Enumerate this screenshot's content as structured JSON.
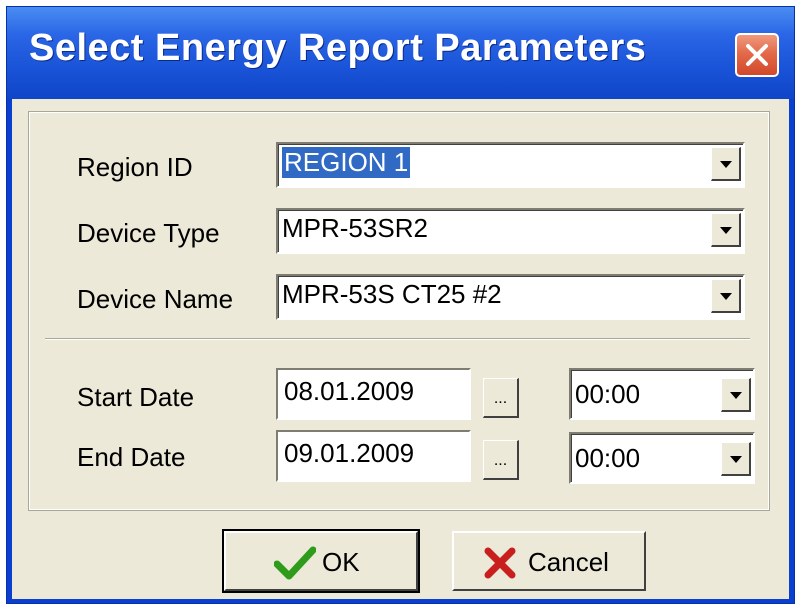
{
  "window": {
    "title": "Select Energy Report Parameters",
    "close_icon": "close-icon",
    "titlebar_color": "#1a54d8",
    "close_color": "#d2492b"
  },
  "fields": {
    "region": {
      "label": "Region ID",
      "value": "REGION 1"
    },
    "device_type": {
      "label": "Device Type",
      "value": "MPR-53SR2"
    },
    "device_name": {
      "label": "Device Name",
      "value": "MPR-53S CT25 #2"
    },
    "start": {
      "label": "Start Date",
      "date": "08.01.2009",
      "picker_label": "...",
      "time": "00:00"
    },
    "end": {
      "label": "End Date",
      "date": "09.01.2009",
      "picker_label": "...",
      "time": "00:00"
    }
  },
  "buttons": {
    "ok": {
      "label": "OK",
      "icon": "checkmark-icon",
      "icon_color": "#2e9b1a"
    },
    "cancel": {
      "label": "Cancel",
      "icon": "x-icon",
      "icon_color": "#c81e1e"
    }
  }
}
